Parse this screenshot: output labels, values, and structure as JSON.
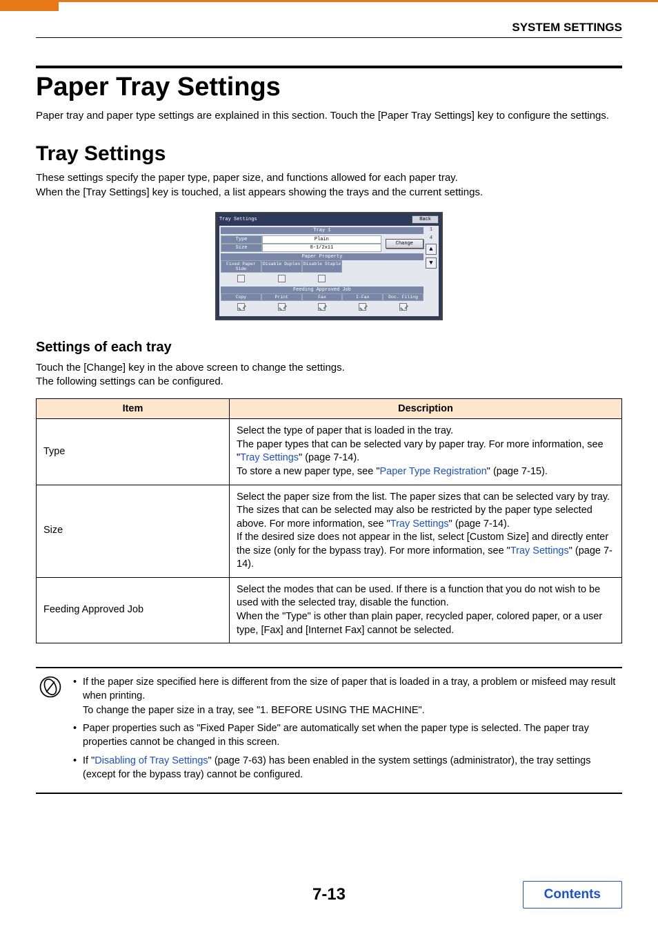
{
  "header": {
    "breadcrumb": "SYSTEM SETTINGS"
  },
  "h1": "Paper Tray Settings",
  "intro": "Paper tray and paper type settings are explained in this section. Touch the [Paper Tray Settings] key to configure the settings.",
  "h2": "Tray Settings",
  "tray_p1": "These settings specify the paper type, paper size, and functions allowed for each paper tray.",
  "tray_p2": "When the [Tray Settings] key is touched, a list appears showing the trays and the current settings.",
  "panel": {
    "title": "Tray Settings",
    "back": "Back",
    "tray": "Tray 1",
    "type_label": "Type",
    "type_value": "Plain",
    "size_label": "Size",
    "size_value": "8-1/2x11",
    "change": "Change",
    "prop_header": "Paper Property",
    "props": [
      "Fixed Paper Side",
      "Disable Duplex",
      "Disable Staple"
    ],
    "job_header": "Feeding Approved Job",
    "jobs": [
      "Copy",
      "Print",
      "Fax",
      "I-Fax",
      "Doc. Filing"
    ],
    "page_cur": "1",
    "page_total": "4"
  },
  "h3": "Settings of each tray",
  "sub_p1": "Touch the [Change] key in the above screen to change the settings.",
  "sub_p2": "The following settings can be configured.",
  "table": {
    "head_item": "Item",
    "head_desc": "Description",
    "rows": [
      {
        "item": "Type",
        "d1": "Select the type of paper that is loaded in the tray.",
        "d2a": "The paper types that can be selected vary by paper tray. For more information, see \"",
        "d2link": "Tray Settings",
        "d2b": "\" (page 7-14).",
        "d3a": "To store a new paper type, see \"",
        "d3link": "Paper Type Registration",
        "d3b": "\" (page 7-15)."
      },
      {
        "item": "Size",
        "d1a": "Select the paper size from the list. The paper sizes that can be selected vary by tray. The sizes that can be selected may also be restricted by the paper type selected above. For more information, see \"",
        "d1link": "Tray Settings",
        "d1b": "\" (page 7-14).",
        "d2a": "If the desired size does not appear in the list, select [Custom Size] and directly enter the size (only for the bypass tray). For more information, see \"",
        "d2link": "Tray Settings",
        "d2b": "\" (page 7-14)."
      },
      {
        "item": "Feeding Approved Job",
        "d1": "Select the modes that can be used. If there is a function that you do not wish to be used with the selected tray, disable the function.",
        "d2": "When the \"Type\" is other than plain paper, recycled paper, colored paper, or a user type, [Fax] and [Internet Fax] cannot be selected."
      }
    ]
  },
  "notes": {
    "n1": "If the paper size specified here is different from the size of paper that is loaded in a tray, a problem or misfeed may result when printing.",
    "n1b": "To change the paper size in a tray, see \"1. BEFORE USING THE MACHINE\".",
    "n2": "Paper properties such as \"Fixed Paper Side\" are automatically set when the paper type is selected. The paper tray properties cannot be changed in this screen.",
    "n3a": "If \"",
    "n3link": "Disabling of Tray Settings",
    "n3b": "\" (page 7-63) has been enabled in the system settings (administrator), the tray settings (except for the bypass tray) cannot be configured."
  },
  "footer": {
    "page": "7-13",
    "contents": "Contents"
  }
}
